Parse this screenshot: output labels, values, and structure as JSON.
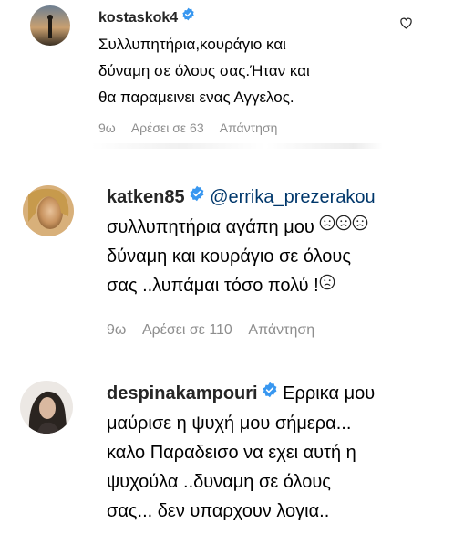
{
  "comments": [
    {
      "username": "kostaskok4",
      "lines": [
        "Συλλυπητήρια,κουράγιο και",
        "δύναμη σε όλους σας.Ήταν και",
        "θα παραμεινει ενας Αγγελος."
      ],
      "time": "9ω",
      "likes": "Αρέσει σε 63",
      "reply": "Απάντηση"
    },
    {
      "username": "katken85",
      "mention": "@errika_prezerakou",
      "lines": [
        "συλλυπητήρια αγάπη μου",
        "δύναμη και κουράγιο σε όλους",
        "σας ..λυπάμαι τόσο πολύ !"
      ],
      "time": "9ω",
      "likes": "Αρέσει σε 110",
      "reply": "Απάντηση"
    },
    {
      "username": "despinakampouri",
      "first_text": "Ερρικα μου",
      "lines": [
        "μαύρισε η ψυχή μου σήμερα...",
        "καλο Παραδεισο να εχει αυτή η",
        "ψυχούλα ..δυναμη σε όλους",
        "σας... δεν υπαρχουν λογια.."
      ]
    }
  ],
  "icons": {
    "verified": "verified-badge-icon",
    "heart": "heart-outline-icon",
    "emoji": "sad-face-emoji-icon"
  },
  "colors": {
    "verified_blue": "#3897f0",
    "meta_gray": "#8e8e8e",
    "mention_blue": "#00376b"
  }
}
